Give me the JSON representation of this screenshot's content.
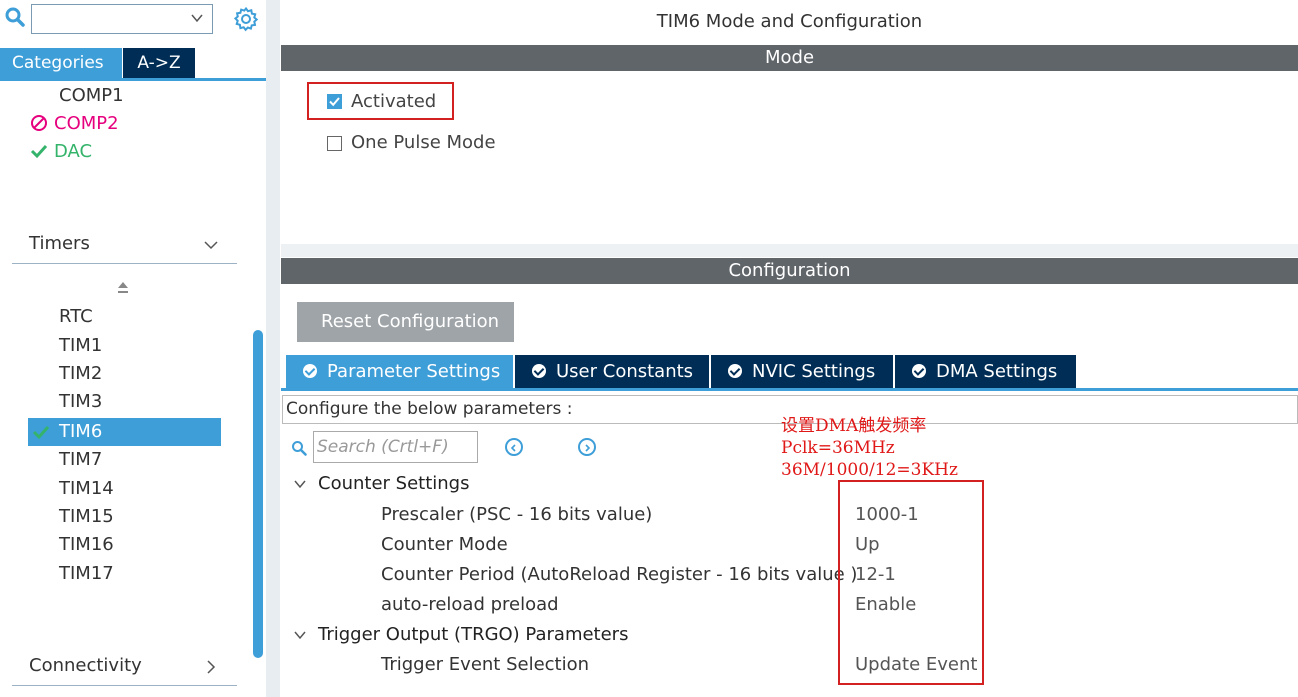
{
  "sidebar": {
    "search": {
      "value": "",
      "placeholder": ""
    },
    "tabs": {
      "categories": "Categories",
      "az": "A->Z"
    },
    "analog_items": [
      {
        "label": "COMP1",
        "status": "none"
      },
      {
        "label": "COMP2",
        "status": "disabled"
      },
      {
        "label": "DAC",
        "status": "enabled"
      }
    ],
    "timers_group": "Timers",
    "timer_items": [
      "RTC",
      "TIM1",
      "TIM2",
      "TIM3",
      "TIM6",
      "TIM7",
      "TIM14",
      "TIM15",
      "TIM16",
      "TIM17"
    ],
    "selected_timer": "TIM6",
    "connectivity_group": "Connectivity"
  },
  "panel": {
    "title": "TIM6 Mode and Configuration",
    "mode_header": "Mode",
    "activated_label": "Activated",
    "activated_checked": true,
    "one_pulse_label": "One Pulse Mode",
    "one_pulse_checked": false,
    "configuration_header": "Configuration",
    "reset_button": "Reset Configuration",
    "tabs": [
      "Parameter Settings",
      "User Constants",
      "NVIC Settings",
      "DMA Settings"
    ],
    "active_tab": "Parameter Settings",
    "configure_text": "Configure the below parameters :",
    "search_placeholder": "Search (Crtl+F)",
    "counter_group": "Counter Settings",
    "trigger_group": "Trigger Output (TRGO) Parameters",
    "parameters": [
      {
        "name": "Prescaler (PSC - 16 bits value)",
        "value": "1000-1"
      },
      {
        "name": "Counter Mode",
        "value": "Up"
      },
      {
        "name": "Counter Period (AutoReload Register - 16 bits value )",
        "value": "12-1"
      },
      {
        "name": "auto-reload preload",
        "value": "Enable"
      },
      {
        "name": "Trigger Event Selection",
        "value": "Update Event"
      }
    ]
  },
  "annotation": {
    "line1": "设置DMA触发频率",
    "line2": "Pclk=36MHz",
    "line3": "36M/1000/12=3KHz"
  },
  "colors": {
    "accent": "#3e9ed8",
    "navy": "#002d55",
    "section_bar": "#60656a",
    "disabled_pink": "#e6007e",
    "enabled_green": "#34b36a",
    "annotation_red": "#d32020"
  }
}
